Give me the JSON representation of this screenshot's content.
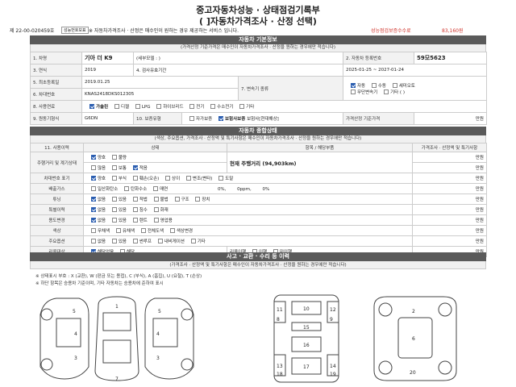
{
  "doc": {
    "title_main": "중고자동차성능 · 상태점검기록부",
    "title_sub": "(   ]자동차가격조사 · 산정 선택)",
    "number": "제 22-00-020459호",
    "stamp": "성능번호보표",
    "notice": "※ 자동차가격조사 · 산정은 매수인이 원하는 경우 제공하는 서비스 입니다.",
    "fee_label": "성능점검보증수수료",
    "fee_value": "83,160원"
  },
  "basic": {
    "heading": "자동차 기본정보",
    "subheading": "(가격산정 기준가격은 매수인이 자동차가격조사 · 산정을 원하는 경우에만 적습니다)",
    "r1": [
      "1. 차명",
      "기아 더 K9",
      "(세부모델 : )",
      "2. 자동차 등록번호",
      "59모5623"
    ],
    "r2": [
      "3. 연식",
      "2019",
      "4. 검사유효기간",
      "2025-01-25 ~ 2027-01-24"
    ],
    "r3": [
      "5. 최초등록일",
      "2019.01.25",
      "7. 변속기 종류"
    ],
    "r4": [
      "6. 차대번호",
      "KNAS2418DKS012305"
    ],
    "trans_opts": [
      "자동",
      "수동",
      "세미오토",
      "무단변속기",
      "기타 ( )"
    ],
    "r5_label": "8. 사용연료",
    "fuel_opts": [
      "가솔린",
      "디젤",
      "LPG",
      "하이브리드",
      "전기",
      "수소전기",
      "기타"
    ],
    "r6": [
      "9. 원동기형식",
      "G6DN",
      "10. 보증유형"
    ],
    "warranty_opts": [
      "자가보증",
      "보험사보증",
      "보험사[현대해상]"
    ],
    "price_label": "가격산정 기준가격",
    "price_unit": "만원"
  },
  "state": {
    "heading": "자동차 종합상태",
    "subheading": "(색상, 주요옵션, 가격조사 · 산정액 및 특기사항은 매수인이 자동차가격조사 · 산정을 원하는 경우에만 적습니다)",
    "cols": [
      "11. 사용이력",
      "상태",
      "항목 / 해당부품",
      "가격조사 · 산정액 및 특기사항"
    ],
    "mileage_label": "주행거리 및 계기상태",
    "mileage_opts1": [
      "양호",
      "불량"
    ],
    "mileage_opts2": [
      "많음",
      "보통",
      "적음"
    ],
    "mileage_value": "현재 주행거리 (94,903km)",
    "vin_label": "차대번호 표기",
    "vin_opts": [
      "양호",
      "부식",
      "훼손(오손)",
      "상이",
      "변조(변타)",
      "도말"
    ],
    "emission_label": "배출가스",
    "emission_opts": [
      "일산화탄소",
      "탄화수소",
      "매연"
    ],
    "emission_vals": [
      "0%,",
      "0ppm,",
      "0%"
    ],
    "tuning_label": "튜닝",
    "tuning_opts": [
      "없음",
      "있음",
      "적법",
      "불법",
      "구조",
      "장치"
    ],
    "special_label": "특별이력",
    "special_opts": [
      "없음",
      "있음",
      "침수",
      "화재"
    ],
    "usage_label": "용도변경",
    "usage_opts": [
      "없음",
      "있음",
      "렌트",
      "영업용"
    ],
    "color_label": "색상",
    "color_opts": [
      "무채색",
      "유채색",
      "전체도색",
      "색상변경"
    ],
    "option_label": "주요옵션",
    "option_opts": [
      "없음",
      "있음",
      "썬루프",
      "내비게이션",
      "기타"
    ],
    "recall_label": "리콜대상",
    "recall_opts": [
      "해당없음",
      "해당",
      "리콜이행",
      "이행",
      "미이행"
    ],
    "unit": "만원"
  },
  "accident": {
    "heading": "사고 · 교환 · 수리 등 이력",
    "subheading": "(가격조사 · 산정액 및 특기사항은 매수인이 자동차가격조사 · 산정을 원하는 경우에만 적습니다)",
    "note1": "※ 상태표시 부호 : X (교환), W (판금 또는 용접), C (부식), A (흠집), U (요철), T (손상)",
    "note2": "※ 하단 항목은 승용차 기준이며, 기타 자동차는 승용차에 준하여 표시"
  },
  "diagram_numbers": [
    "1",
    "2",
    "3",
    "4",
    "5",
    "6",
    "7",
    "8",
    "9",
    "10",
    "11",
    "12",
    "13",
    "14",
    "15",
    "16",
    "17",
    "18",
    "19",
    "20"
  ]
}
